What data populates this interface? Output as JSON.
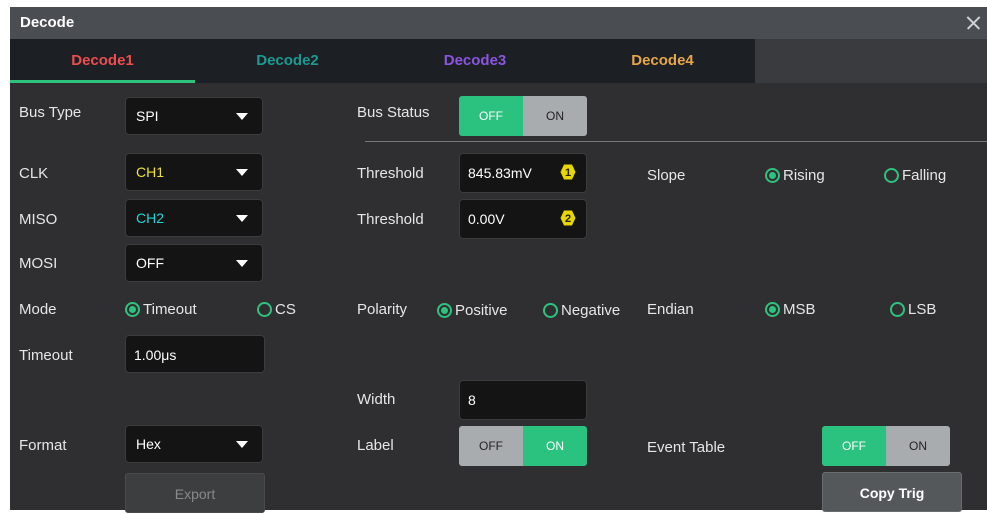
{
  "window": {
    "title": "Decode"
  },
  "tabs": [
    {
      "label": "Decode1",
      "color": "#ee4d4d",
      "active": true
    },
    {
      "label": "Decode2",
      "color": "#1a9a92",
      "active": false
    },
    {
      "label": "Decode3",
      "color": "#8a55e0",
      "active": false
    },
    {
      "label": "Decode4",
      "color": "#e8a64a",
      "active": false
    }
  ],
  "bus_type": {
    "label": "Bus Type",
    "value": "SPI"
  },
  "bus_status": {
    "label": "Bus Status",
    "off": "OFF",
    "on": "ON",
    "selected": "OFF"
  },
  "clk": {
    "label": "CLK",
    "value": "CH1",
    "value_color": "#f0e030"
  },
  "miso": {
    "label": "MISO",
    "value": "CH2",
    "value_color": "#1ed6d6"
  },
  "mosi": {
    "label": "MOSI",
    "value": "OFF"
  },
  "threshold1": {
    "label": "Threshold",
    "value": "845.83mV",
    "badge": "1"
  },
  "threshold2": {
    "label": "Threshold",
    "value": "0.00V",
    "badge": "2"
  },
  "slope": {
    "label": "Slope",
    "options": [
      "Rising",
      "Falling"
    ],
    "selected": "Rising"
  },
  "mode": {
    "label": "Mode",
    "options": [
      "Timeout",
      "CS"
    ],
    "selected": "Timeout"
  },
  "polarity": {
    "label": "Polarity",
    "options": [
      "Positive",
      "Negative"
    ],
    "selected": "Positive"
  },
  "endian": {
    "label": "Endian",
    "options": [
      "MSB",
      "LSB"
    ],
    "selected": "MSB"
  },
  "timeout": {
    "label": "Timeout",
    "value": "1.00μs"
  },
  "width": {
    "label": "Width",
    "value": "8"
  },
  "format": {
    "label": "Format",
    "value": "Hex"
  },
  "label_toggle": {
    "label": "Label",
    "off": "OFF",
    "on": "ON",
    "selected": "ON"
  },
  "event_table": {
    "label": "Event Table",
    "off": "OFF",
    "on": "ON",
    "selected": "OFF"
  },
  "buttons": {
    "export": "Export",
    "copy_trig": "Copy Trig"
  }
}
